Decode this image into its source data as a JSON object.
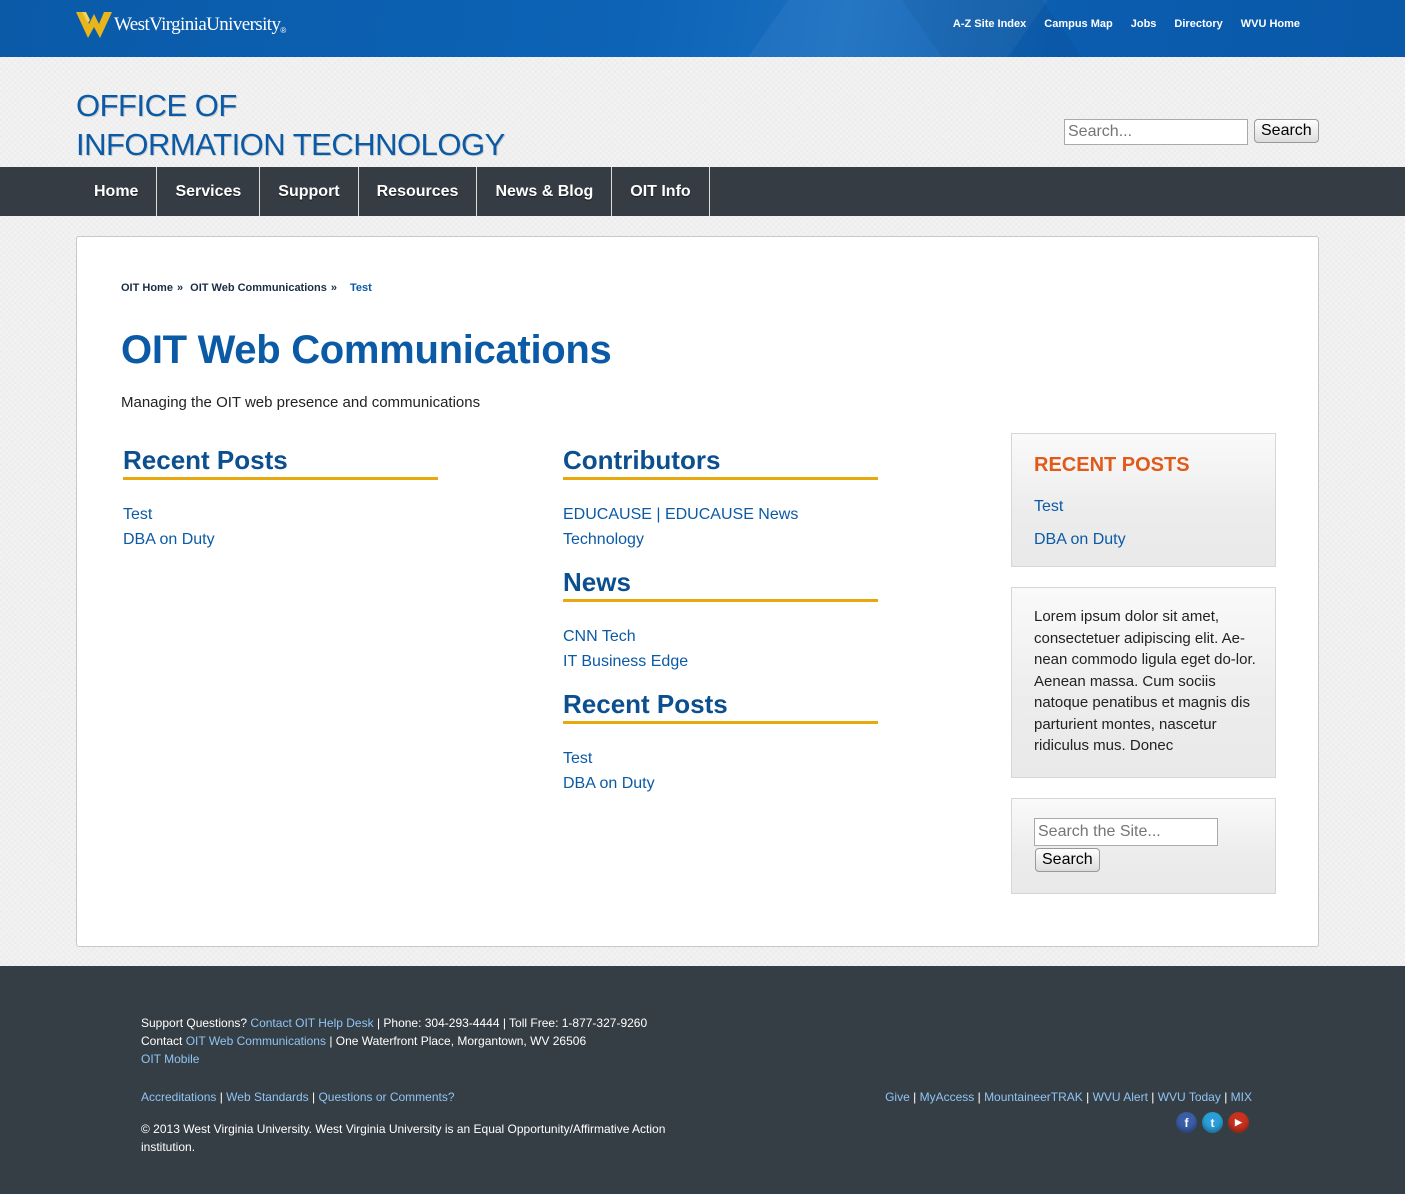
{
  "topbar": {
    "logo_text": "WestVirginiaUniversity",
    "links": [
      "A-Z Site Index",
      "Campus Map",
      "Jobs",
      "Directory",
      "WVU Home"
    ]
  },
  "header": {
    "title_line1": "OFFICE OF",
    "title_line2": "INFORMATION TECHNOLOGY",
    "search_placeholder": "Search...",
    "search_button": "Search"
  },
  "nav": [
    "Home",
    "Services",
    "Support",
    "Resources",
    "News & Blog",
    "OIT Info"
  ],
  "breadcrumb": {
    "items": [
      "OIT Home",
      "OIT Web Communications"
    ],
    "separator": "»",
    "current": "Test"
  },
  "page": {
    "title": "OIT Web Communications",
    "description": "Managing the OIT web presence and communications"
  },
  "col1": {
    "heading": "Recent Posts",
    "links": [
      "Test",
      "DBA on Duty"
    ]
  },
  "col2": {
    "contributors": {
      "heading": "Contributors",
      "links": [
        "EDUCAUSE | EDUCAUSE News",
        "Technology"
      ]
    },
    "news": {
      "heading": "News",
      "links": [
        "CNN Tech",
        "IT Business Edge"
      ]
    },
    "recent": {
      "heading": "Recent Posts",
      "links": [
        "Test",
        "DBA on Duty"
      ]
    }
  },
  "sidebar": {
    "recent_heading": "RECENT POSTS",
    "recent_links": [
      "Test",
      "DBA on Duty"
    ],
    "lorem": "Lorem ipsum dolor sit amet, consectetuer adipiscing elit. Ae-nean commodo ligula eget do-lor. Aenean massa. Cum sociis natoque penatibus et magnis dis parturient montes, nascetur ridiculus mus. Donec",
    "search_placeholder": "Search the Site...",
    "search_button": "Search"
  },
  "footer": {
    "support_prefix": "Support Questions?",
    "helpdesk_link": "Contact OIT Help Desk",
    "phone_text": "| Phone: 304-293-4444 | Toll Free: 1-877-327-9260",
    "contact_prefix": "Contact",
    "contact_link": "OIT Web Communications",
    "address_text": "| One Waterfront Place, Morgantown, WV 26506",
    "mobile_link": "OIT Mobile",
    "left_links": [
      "Accreditations",
      "Web Standards",
      "Questions or Comments?"
    ],
    "right_links": [
      "Give",
      "MyAccess",
      "MountaineerTRAK",
      "WVU Alert",
      "WVU Today",
      "MIX"
    ],
    "copyright": "© 2013 West Virginia University. West Virginia University is an Equal Opportunity/Affirmative Action institution.",
    "social": [
      {
        "icon": "facebook-icon",
        "glyph": "f",
        "color": "#3b5ea8"
      },
      {
        "icon": "twitter-icon",
        "glyph": "t",
        "color": "#2a9fd8"
      },
      {
        "icon": "youtube-icon",
        "glyph": "▶",
        "color": "#c8321f"
      }
    ]
  },
  "colors": {
    "brand_blue": "#0b5aa6",
    "gold": "#e8a90e",
    "nav_bg": "#353c43",
    "sidebar_heading": "#e05a1a"
  }
}
